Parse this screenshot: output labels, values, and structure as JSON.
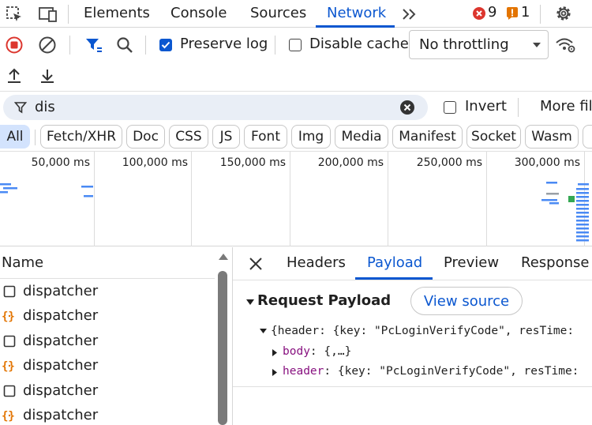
{
  "tabs": [
    "Elements",
    "Console",
    "Sources",
    "Network"
  ],
  "error_count": "9",
  "warning_count": "1",
  "toolbar": {
    "preserve_log": "Preserve log",
    "disable_cache": "Disable cache",
    "throttling": "No throttling"
  },
  "filter": {
    "value": "dis",
    "invert": "Invert",
    "more_filters": "More fil"
  },
  "types": [
    "All",
    "Fetch/XHR",
    "Doc",
    "CSS",
    "JS",
    "Font",
    "Img",
    "Media",
    "Manifest",
    "Socket",
    "Wasm"
  ],
  "timeline_ticks": [
    "50,000 ms",
    "100,000 ms",
    "150,000 ms",
    "200,000 ms",
    "250,000 ms",
    "300,000 ms"
  ],
  "requests": {
    "header": "Name",
    "rows": [
      "dispatcher",
      "dispatcher",
      "dispatcher",
      "dispatcher",
      "dispatcher",
      "dispatcher"
    ]
  },
  "detail_tabs": [
    "Headers",
    "Payload",
    "Preview",
    "Response"
  ],
  "payload": {
    "section_title": "Request Payload",
    "view_source": "View source",
    "root_line": "{header: {key: \"PcLoginVerifyCode\", resTime:",
    "body_key": "body",
    "body_value": "{,…}",
    "header_key": "header",
    "header_value": "{key: \"PcLoginVerifyCode\", resTime:"
  },
  "colors": {
    "accent": "#0b57d0",
    "error": "#dc362e",
    "warning": "#e37400",
    "json_key": "#881280"
  }
}
